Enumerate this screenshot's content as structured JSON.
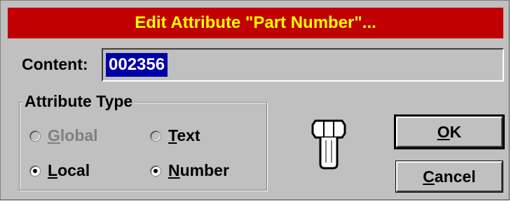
{
  "colors": {
    "title_bg": "#c00000",
    "title_fg": "#ffff00",
    "dialog_bg": "#c0c0c0",
    "selection_bg": "#0000a8",
    "selection_fg": "#ffffff",
    "disabled_fg": "#808080"
  },
  "window": {
    "title": "Edit Attribute \"Part Number\"..."
  },
  "content": {
    "label": "Content:",
    "value": "002356"
  },
  "attribute_type": {
    "legend": "Attribute Type",
    "options": [
      {
        "label": "Global",
        "checked": false,
        "enabled": false
      },
      {
        "label": "Text",
        "checked": false,
        "enabled": true
      },
      {
        "label": "Local",
        "checked": true,
        "enabled": true
      },
      {
        "label": "Number",
        "checked": true,
        "enabled": true
      }
    ]
  },
  "icon": {
    "name": "bolt-icon"
  },
  "buttons": {
    "ok": "OK",
    "cancel": "Cancel"
  }
}
